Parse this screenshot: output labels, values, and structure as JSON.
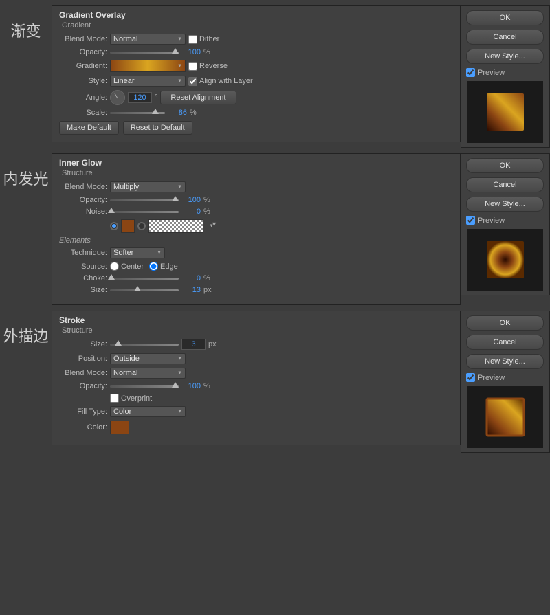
{
  "panels": {
    "gradient": {
      "title": "Gradient Overlay",
      "subtitle": "Gradient",
      "chinese_label": "渐变",
      "blend_mode_label": "Blend Mode:",
      "blend_mode_value": "Normal",
      "dither_label": "Dither",
      "opacity_label": "Opacity:",
      "opacity_value": "100",
      "opacity_unit": "%",
      "gradient_label": "Gradient:",
      "reverse_label": "Reverse",
      "style_label": "Style:",
      "style_value": "Linear",
      "align_layer_label": "Align with Layer",
      "angle_label": "Angle:",
      "angle_value": "120",
      "angle_unit": "°",
      "reset_alignment": "Reset Alignment",
      "scale_label": "Scale:",
      "scale_value": "86",
      "scale_unit": "%",
      "make_default": "Make Default",
      "reset_to_default": "Reset to Default",
      "ok": "OK",
      "cancel": "Cancel",
      "new_style": "New Style...",
      "preview": "Preview"
    },
    "inner_glow": {
      "title": "Inner Glow",
      "subtitle": "Structure",
      "chinese_label": "内发光",
      "blend_mode_label": "Blend Mode:",
      "blend_mode_value": "Multiply",
      "opacity_label": "Opacity:",
      "opacity_value": "100",
      "opacity_unit": "%",
      "noise_label": "Noise:",
      "noise_value": "0",
      "noise_unit": "%",
      "elements_header": "Elements",
      "technique_label": "Technique:",
      "technique_value": "Softer",
      "source_label": "Source:",
      "source_center": "Center",
      "source_edge": "Edge",
      "choke_label": "Choke:",
      "choke_value": "0",
      "choke_unit": "%",
      "size_label": "Size:",
      "size_value": "13",
      "size_unit": "px",
      "ok": "OK",
      "cancel": "Cancel",
      "new_style": "New Style...",
      "preview": "Preview"
    },
    "stroke": {
      "title": "Stroke",
      "subtitle": "Structure",
      "chinese_label": "外描边",
      "size_label": "Size:",
      "size_value": "3",
      "size_unit": "px",
      "position_label": "Position:",
      "position_value": "Outside",
      "blend_mode_label": "Blend Mode:",
      "blend_mode_value": "Normal",
      "opacity_label": "Opacity:",
      "opacity_value": "100",
      "opacity_unit": "%",
      "overprint_label": "Overprint",
      "fill_type_label": "Fill Type:",
      "fill_type_value": "Color",
      "color_label": "Color:",
      "ok": "OK",
      "cancel": "Cancel",
      "new_style": "New Style...",
      "preview": "Preview"
    }
  }
}
